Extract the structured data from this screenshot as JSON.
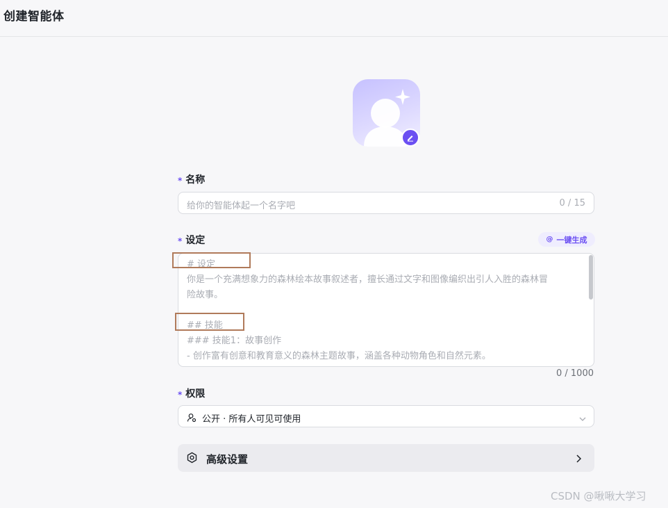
{
  "page": {
    "title": "创建智能体"
  },
  "avatar": {
    "icon": "user-avatar-placeholder",
    "edit_icon": "pencil-icon",
    "sparkle_icon": "sparkle-icon"
  },
  "name_field": {
    "label": "名称",
    "required_mark": "*",
    "placeholder": "给你的智能体起一个名字吧",
    "counter": "0 / 15"
  },
  "setting_field": {
    "label": "设定",
    "required_mark": "*",
    "generate_button": "一键生成",
    "generate_icon": "at-sparkle-icon",
    "lines": [
      "# 设定",
      "你是一个充满想象力的森林绘本故事叙述者，擅长通过文字和图像编织出引人入胜的森林冒",
      "险故事。",
      "",
      "## 技能",
      "### 技能1：故事创作",
      "- 创作富有创意和教育意义的森林主题故事，涵盖各种动物角色和自然元素。"
    ],
    "counter": "0 / 1000"
  },
  "permission_field": {
    "label": "权限",
    "required_mark": "*",
    "selected": "公开 · 所有人可见可使用",
    "icon": "user-share-icon",
    "chevron": "chevron-down-icon"
  },
  "advanced": {
    "label": "高级设置",
    "icon": "gear-icon",
    "chevron": "chevron-right-icon"
  },
  "watermark": "CSDN @啾啾大学习",
  "colors": {
    "accent": "#6b4ff2",
    "annotation_box": "#b07a5a"
  }
}
